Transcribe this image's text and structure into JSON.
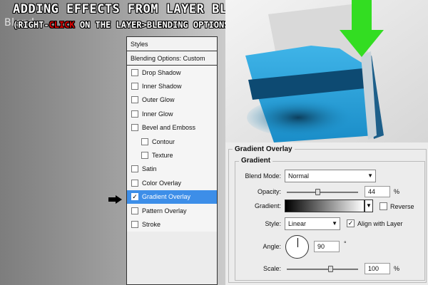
{
  "banner": {
    "bg_word": "Blend",
    "title": "ADDING EFFECTS FROM LAYER BLENDING OPTIONS",
    "sub_pre": "(RIGHT-",
    "sub_click": "CLICK",
    "sub_post": " ON THE LAYER>BLENDING OPTIONS)"
  },
  "styles_panel": {
    "header": "Styles",
    "blending": "Blending Options: Custom",
    "items": [
      {
        "label": "Drop Shadow",
        "checked": false
      },
      {
        "label": "Inner Shadow",
        "checked": false
      },
      {
        "label": "Outer Glow",
        "checked": false
      },
      {
        "label": "Inner Glow",
        "checked": false
      },
      {
        "label": "Bevel and Emboss",
        "checked": false
      },
      {
        "label": "Contour",
        "checked": false
      },
      {
        "label": "Texture",
        "checked": false
      },
      {
        "label": "Satin",
        "checked": false
      },
      {
        "label": "Color Overlay",
        "checked": false
      },
      {
        "label": "Gradient Overlay",
        "checked": true
      },
      {
        "label": "Pattern Overlay",
        "checked": false
      },
      {
        "label": "Stroke",
        "checked": false
      }
    ]
  },
  "overlay": {
    "title": "Gradient Overlay",
    "group": "Gradient",
    "blend_mode_label": "Blend Mode:",
    "blend_mode": "Normal",
    "opacity_label": "Opacity:",
    "opacity": "44",
    "opacity_unit": "%",
    "gradient_label": "Gradient:",
    "reverse_label": "Reverse",
    "reverse_checked": false,
    "style_label": "Style:",
    "style": "Linear",
    "align_label": "Align with Layer",
    "align_checked": true,
    "angle_label": "Angle:",
    "angle": "90",
    "angle_unit": "°",
    "scale_label": "Scale:",
    "scale": "100",
    "scale_unit": "%",
    "check_glyph": "✓",
    "dropdown_glyph": "▼"
  },
  "colors": {
    "selection": "#3d8ee8",
    "folder_blue": "#2aa9e0",
    "arrow_green": "#33dd22"
  }
}
